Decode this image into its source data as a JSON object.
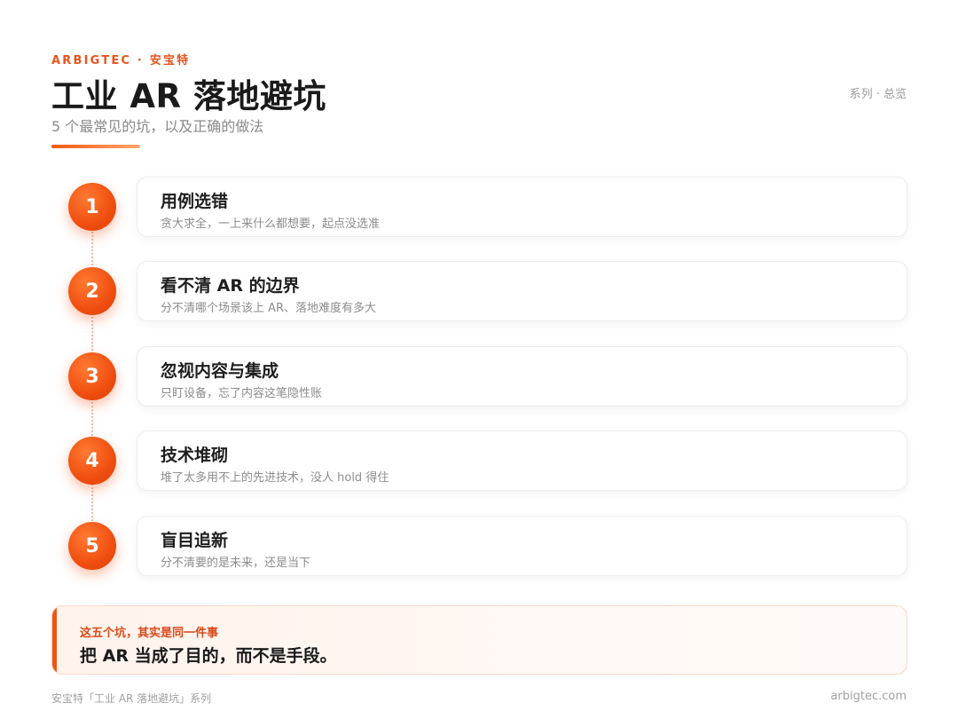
{
  "header": {
    "brand": "ARBIGTEC · 安宝特",
    "title": "工业 AR 落地避坑",
    "subtitle": "5 个最常见的坑，以及正确的做法",
    "series_tag": "系列 · 总览",
    "accent_color": "#F05A12"
  },
  "pitfalls": [
    {
      "number": "1",
      "title": "用例选错",
      "description": "贪大求全，一上来什么都想要，起点没选准"
    },
    {
      "number": "2",
      "title": "看不清 AR 的边界",
      "description": "分不清哪个场景该上 AR、落地难度有多大"
    },
    {
      "number": "3",
      "title": "忽视内容与集成",
      "description": "只盯设备，忘了内容这笔隐性账"
    },
    {
      "number": "4",
      "title": "技术堆砌",
      "description": "堆了太多用不上的先进技术，没人 hold 得住"
    },
    {
      "number": "5",
      "title": "盲目追新",
      "description": "分不清要的是未来，还是当下"
    }
  ],
  "callout": {
    "label": "这五个坑，其实是同一件事",
    "text": "把 AR 当成了目的，而不是手段。"
  },
  "footer": {
    "left": "安宝特「工业 AR 落地避坑」系列",
    "right": "arbigtec.com"
  }
}
